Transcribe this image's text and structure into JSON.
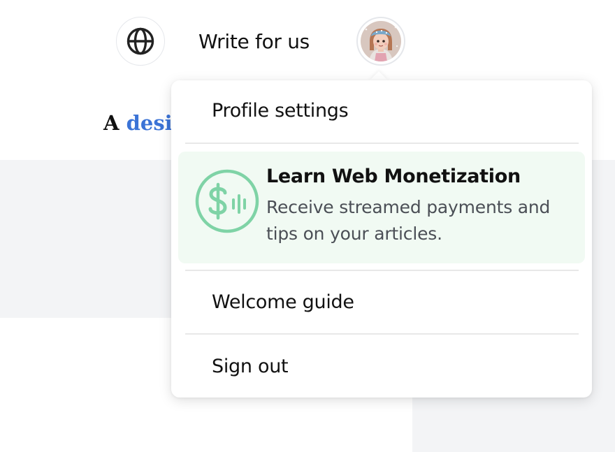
{
  "header": {
    "language_icon": "globe-icon",
    "write_link_label": "Write for us",
    "avatar_icon": "user-avatar"
  },
  "page": {
    "tagline_prefix": "A ",
    "tagline_accent": "desi",
    "tagline_accent_color": "#3b73d6"
  },
  "dropdown": {
    "profile_settings_label": "Profile settings",
    "promo": {
      "icon": "dollar-streaming-icon",
      "title": "Learn Web Monetization",
      "description": "Receive streamed payments and tips on your articles.",
      "accent_color": "#7fd3a6",
      "background_color": "#f1faf3"
    },
    "welcome_guide_label": "Welcome guide",
    "sign_out_label": "Sign out"
  }
}
